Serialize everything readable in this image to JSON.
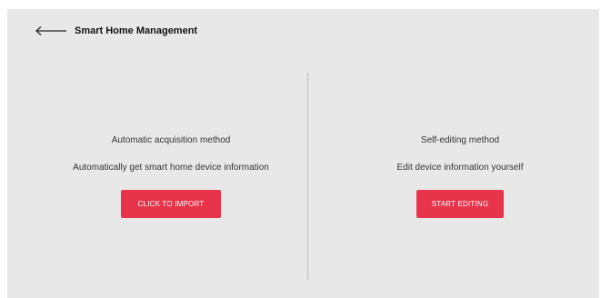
{
  "header": {
    "back_icon": "arrow-left-icon",
    "title": "Smart Home Management"
  },
  "automatic": {
    "title": "Automatic acquisition method",
    "description": "Automatically get smart home device information",
    "button_label": "CLICK TO IMPORT"
  },
  "manual": {
    "title": "Self-editing method",
    "description": "Edit device information yourself",
    "button_label": "START EDITING"
  },
  "colors": {
    "background": "#e8e8e8",
    "accent": "#e8344a",
    "divider": "#bdbdbd"
  }
}
